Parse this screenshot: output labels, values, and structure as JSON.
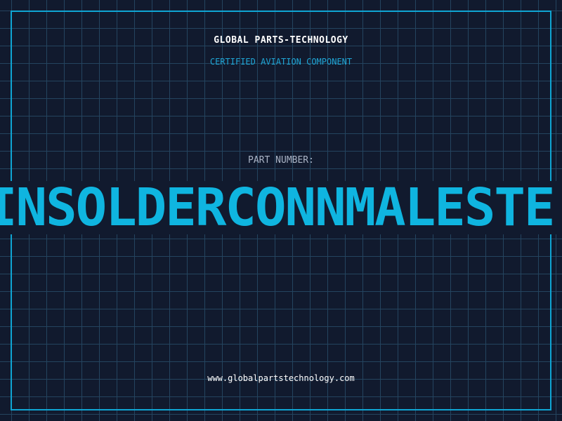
{
  "header": {
    "brand": "GLOBAL PARTS-TECHNOLOGY",
    "subtitle": "CERTIFIED AVIATION COMPONENT"
  },
  "part": {
    "label": "PART NUMBER:",
    "value": "INSOLDERCONNMALESTE"
  },
  "footer": {
    "url": "www.globalpartstechnology.com"
  },
  "colors": {
    "background": "#111a2e",
    "grid": "#24445f",
    "accent": "#0fa5d3",
    "text": "#ffffff",
    "muted": "#aab4c6"
  }
}
